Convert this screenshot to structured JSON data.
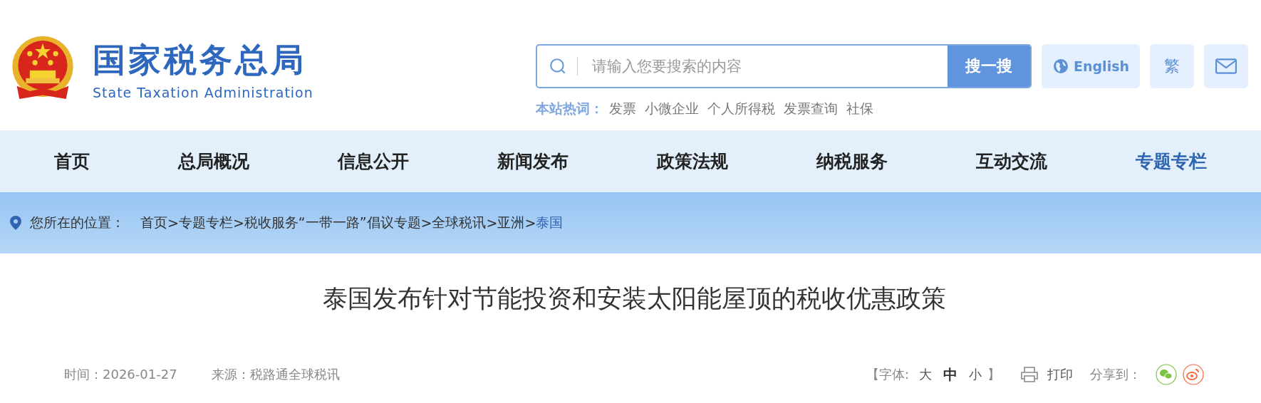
{
  "header": {
    "title": "国家税务总局",
    "subtitle": "State Taxation Administration"
  },
  "search": {
    "placeholder": "请输入您要搜索的内容",
    "button": "搜一搜"
  },
  "header_buttons": [
    {
      "kind": "language",
      "label": "English"
    },
    {
      "kind": "traditional",
      "label": "繁"
    },
    {
      "kind": "mail"
    }
  ],
  "hot_words": {
    "label": "本站热词：",
    "items": [
      "发票",
      "小微企业",
      "个人所得税",
      "发票查询",
      "社保"
    ]
  },
  "nav": [
    {
      "label": "首页",
      "selected": false
    },
    {
      "label": "总局概况",
      "selected": false
    },
    {
      "label": "信息公开",
      "selected": false
    },
    {
      "label": "新闻发布",
      "selected": false
    },
    {
      "label": "政策法规",
      "selected": false
    },
    {
      "label": "纳税服务",
      "selected": false
    },
    {
      "label": "互动交流",
      "selected": false
    },
    {
      "label": "专题专栏",
      "selected": true
    }
  ],
  "breadcrumb": {
    "label": "您所在的位置：",
    "separator": ">",
    "items": [
      {
        "label": "首页",
        "selected": false
      },
      {
        "label": "专题专栏",
        "selected": false
      },
      {
        "label": "税收服务“一带一路”倡议专题",
        "selected": false
      },
      {
        "label": "全球税讯",
        "selected": false
      },
      {
        "label": "亚洲",
        "selected": false
      },
      {
        "label": "泰国",
        "selected": true
      }
    ]
  },
  "article": {
    "title": "泰国发布针对节能投资和安装太阳能屋顶的税收优惠政策",
    "time": "时间：2026-01-27",
    "source": "来源：税路通全球税讯",
    "font_size": {
      "open": "【",
      "label": "字体:",
      "close": "】",
      "options": [
        {
          "label": "大",
          "selected": false
        },
        {
          "label": "中",
          "selected": true
        },
        {
          "label": "小",
          "selected": false
        }
      ]
    },
    "print": "打印",
    "share_label": "分享到："
  }
}
